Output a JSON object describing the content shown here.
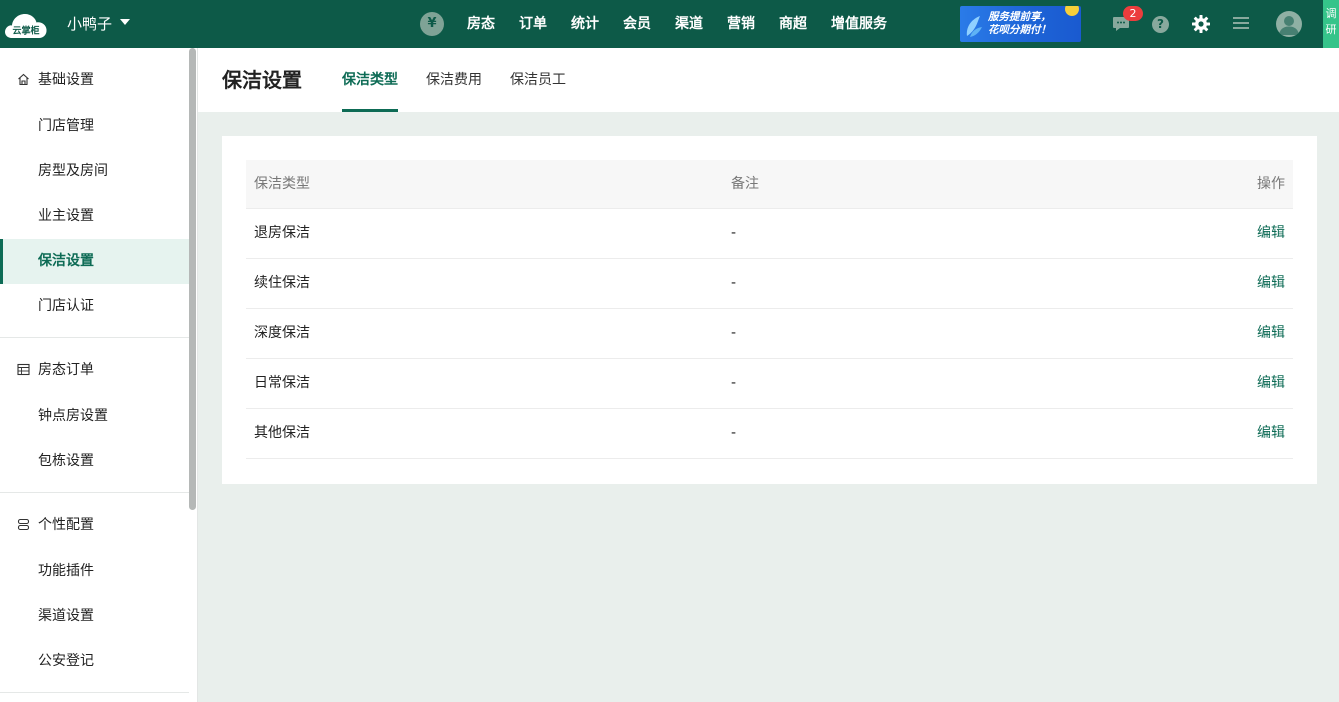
{
  "header": {
    "logo_text": "云掌柜",
    "store_name": "小鸭子",
    "nav": [
      "房态",
      "订单",
      "统计",
      "会员",
      "渠道",
      "营销",
      "商超",
      "增值服务"
    ],
    "yuan_symbol": "¥",
    "banner": {
      "line1": "服务提前享，",
      "line2": "花呗分期付！"
    },
    "message_badge": "2",
    "help_symbol": "?",
    "survey_tab": "调研"
  },
  "sidebar": {
    "groups": [
      {
        "title": "基础设置",
        "icon": "home-icon",
        "items": [
          "门店管理",
          "房型及房间",
          "业主设置",
          "保洁设置",
          "门店认证"
        ]
      },
      {
        "title": "房态订单",
        "icon": "calendar-icon",
        "items": [
          "钟点房设置",
          "包栋设置"
        ]
      },
      {
        "title": "个性配置",
        "icon": "layers-icon",
        "items": [
          "功能插件",
          "渠道设置",
          "公安登记"
        ]
      }
    ],
    "active_item": "保洁设置"
  },
  "page": {
    "title": "保洁设置",
    "tabs": [
      "保洁类型",
      "保洁费用",
      "保洁员工"
    ],
    "active_tab": "保洁类型"
  },
  "table": {
    "columns": [
      "保洁类型",
      "备注",
      "操作"
    ],
    "rows": [
      {
        "type": "退房保洁",
        "note": "-",
        "action": "编辑"
      },
      {
        "type": "续住保洁",
        "note": "-",
        "action": "编辑"
      },
      {
        "type": "深度保洁",
        "note": "-",
        "action": "编辑"
      },
      {
        "type": "日常保洁",
        "note": "-",
        "action": "编辑"
      },
      {
        "type": "其他保洁",
        "note": "-",
        "action": "编辑"
      }
    ]
  },
  "colors": {
    "brand": "#0d5a48",
    "accent": "#0d6b55",
    "badge": "#ec3d3d",
    "survey": "#35c48a"
  }
}
